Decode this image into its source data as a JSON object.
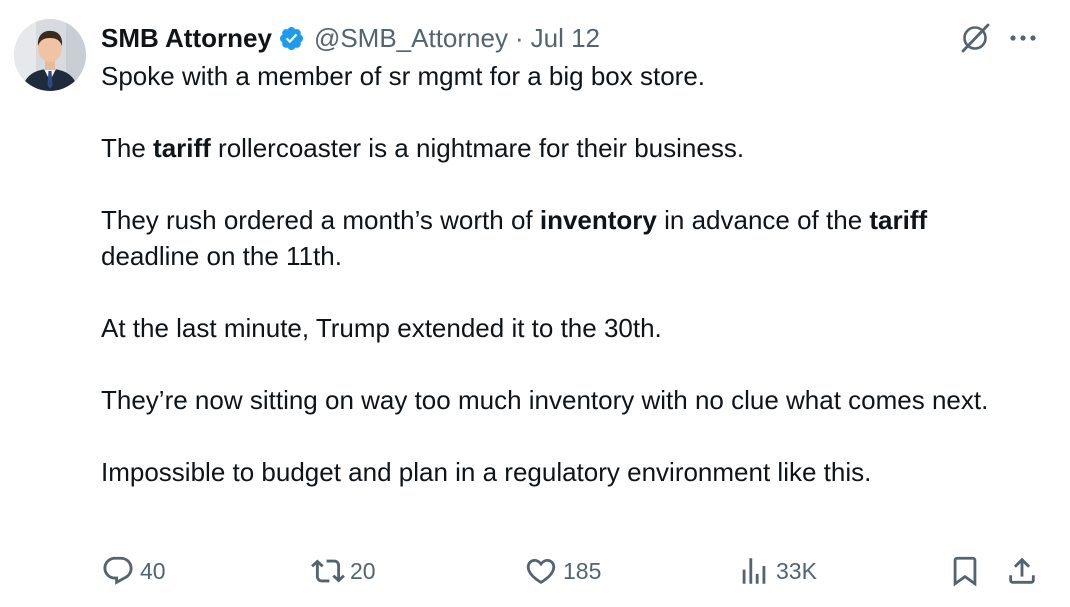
{
  "author": {
    "display_name": "SMB Attorney",
    "handle": "@SMB_Attorney",
    "separator": "·",
    "date": "Jul 12",
    "verified_color": "#1d9bf0"
  },
  "tweet": {
    "p1": "Spoke with a member of sr mgmt for a big box store.",
    "p2": {
      "a": "The ",
      "b": "tariff",
      "c": " rollercoaster is a nightmare for their business."
    },
    "p3": {
      "a": "They rush ordered a month’s worth of ",
      "b": "inventory",
      "c": " in advance of the ",
      "d": "tariff",
      "e": " deadline on the 11th."
    },
    "p4": "At the last minute, Trump extended it to the 30th.",
    "p5": "They’re now sitting on way too much inventory with no clue what comes next.",
    "p6": "Impossible to budget and plan in a regulatory environment like this."
  },
  "actions": {
    "replies": "40",
    "reposts": "20",
    "likes": "185",
    "views": "33K"
  },
  "icons": {
    "reply": "reply-icon",
    "repost": "repost-icon",
    "like": "heart-icon",
    "views": "views-chart-icon",
    "bookmark": "bookmark-icon",
    "share": "share-icon",
    "grok": "grok-icon",
    "more": "more-icon"
  },
  "colors": {
    "text": "#0f1419",
    "secondary": "#536471",
    "accent": "#1d9bf0"
  }
}
